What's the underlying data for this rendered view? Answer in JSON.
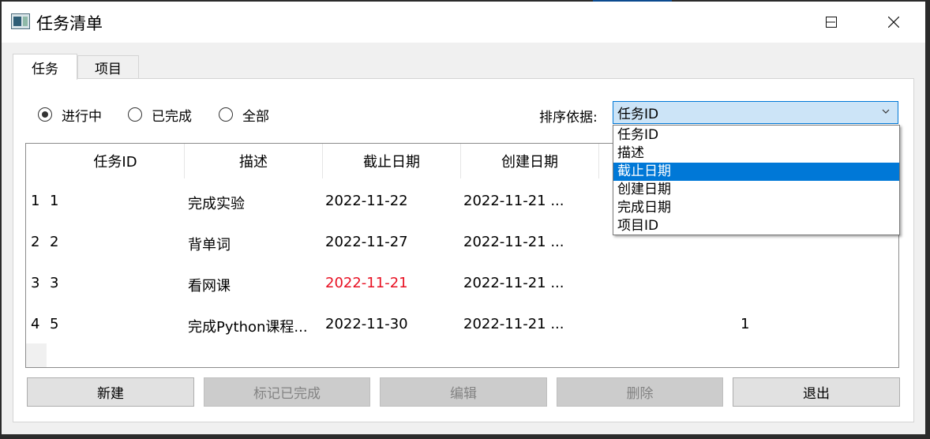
{
  "window": {
    "title": "任务清单"
  },
  "tabs": [
    {
      "label": "任务",
      "active": true
    },
    {
      "label": "项目",
      "active": false
    }
  ],
  "filters": {
    "options": [
      {
        "label": "进行中",
        "checked": true
      },
      {
        "label": "已完成",
        "checked": false
      },
      {
        "label": "全部",
        "checked": false
      }
    ]
  },
  "sort": {
    "label": "排序依据:",
    "selected": "任务ID",
    "options": [
      "任务ID",
      "描述",
      "截止日期",
      "创建日期",
      "完成日期",
      "项目ID"
    ],
    "highlighted_index": 2
  },
  "table": {
    "headers": [
      "任务ID",
      "描述",
      "截止日期",
      "创建日期"
    ],
    "rows": [
      {
        "num": "1",
        "id": "1",
        "desc": "完成实验",
        "due": "2022-11-22",
        "created": "2022-11-21 ...",
        "project": "",
        "overdue": false
      },
      {
        "num": "2",
        "id": "2",
        "desc": "背单词",
        "due": "2022-11-27",
        "created": "2022-11-21 ...",
        "project": "",
        "overdue": false
      },
      {
        "num": "3",
        "id": "3",
        "desc": "看网课",
        "due": "2022-11-21",
        "created": "2022-11-21 ...",
        "project": "",
        "overdue": true
      },
      {
        "num": "4",
        "id": "5",
        "desc": "完成Python课程...",
        "due": "2022-11-30",
        "created": "2022-11-21 ...",
        "project": "1",
        "overdue": false
      }
    ]
  },
  "buttons": {
    "new": "新建",
    "mark_done": "标记已完成",
    "edit": "编辑",
    "delete": "删除",
    "exit": "退出"
  },
  "colors": {
    "accent": "#0078d7",
    "overdue": "#e81123",
    "combo_bg": "#cce4f7"
  }
}
